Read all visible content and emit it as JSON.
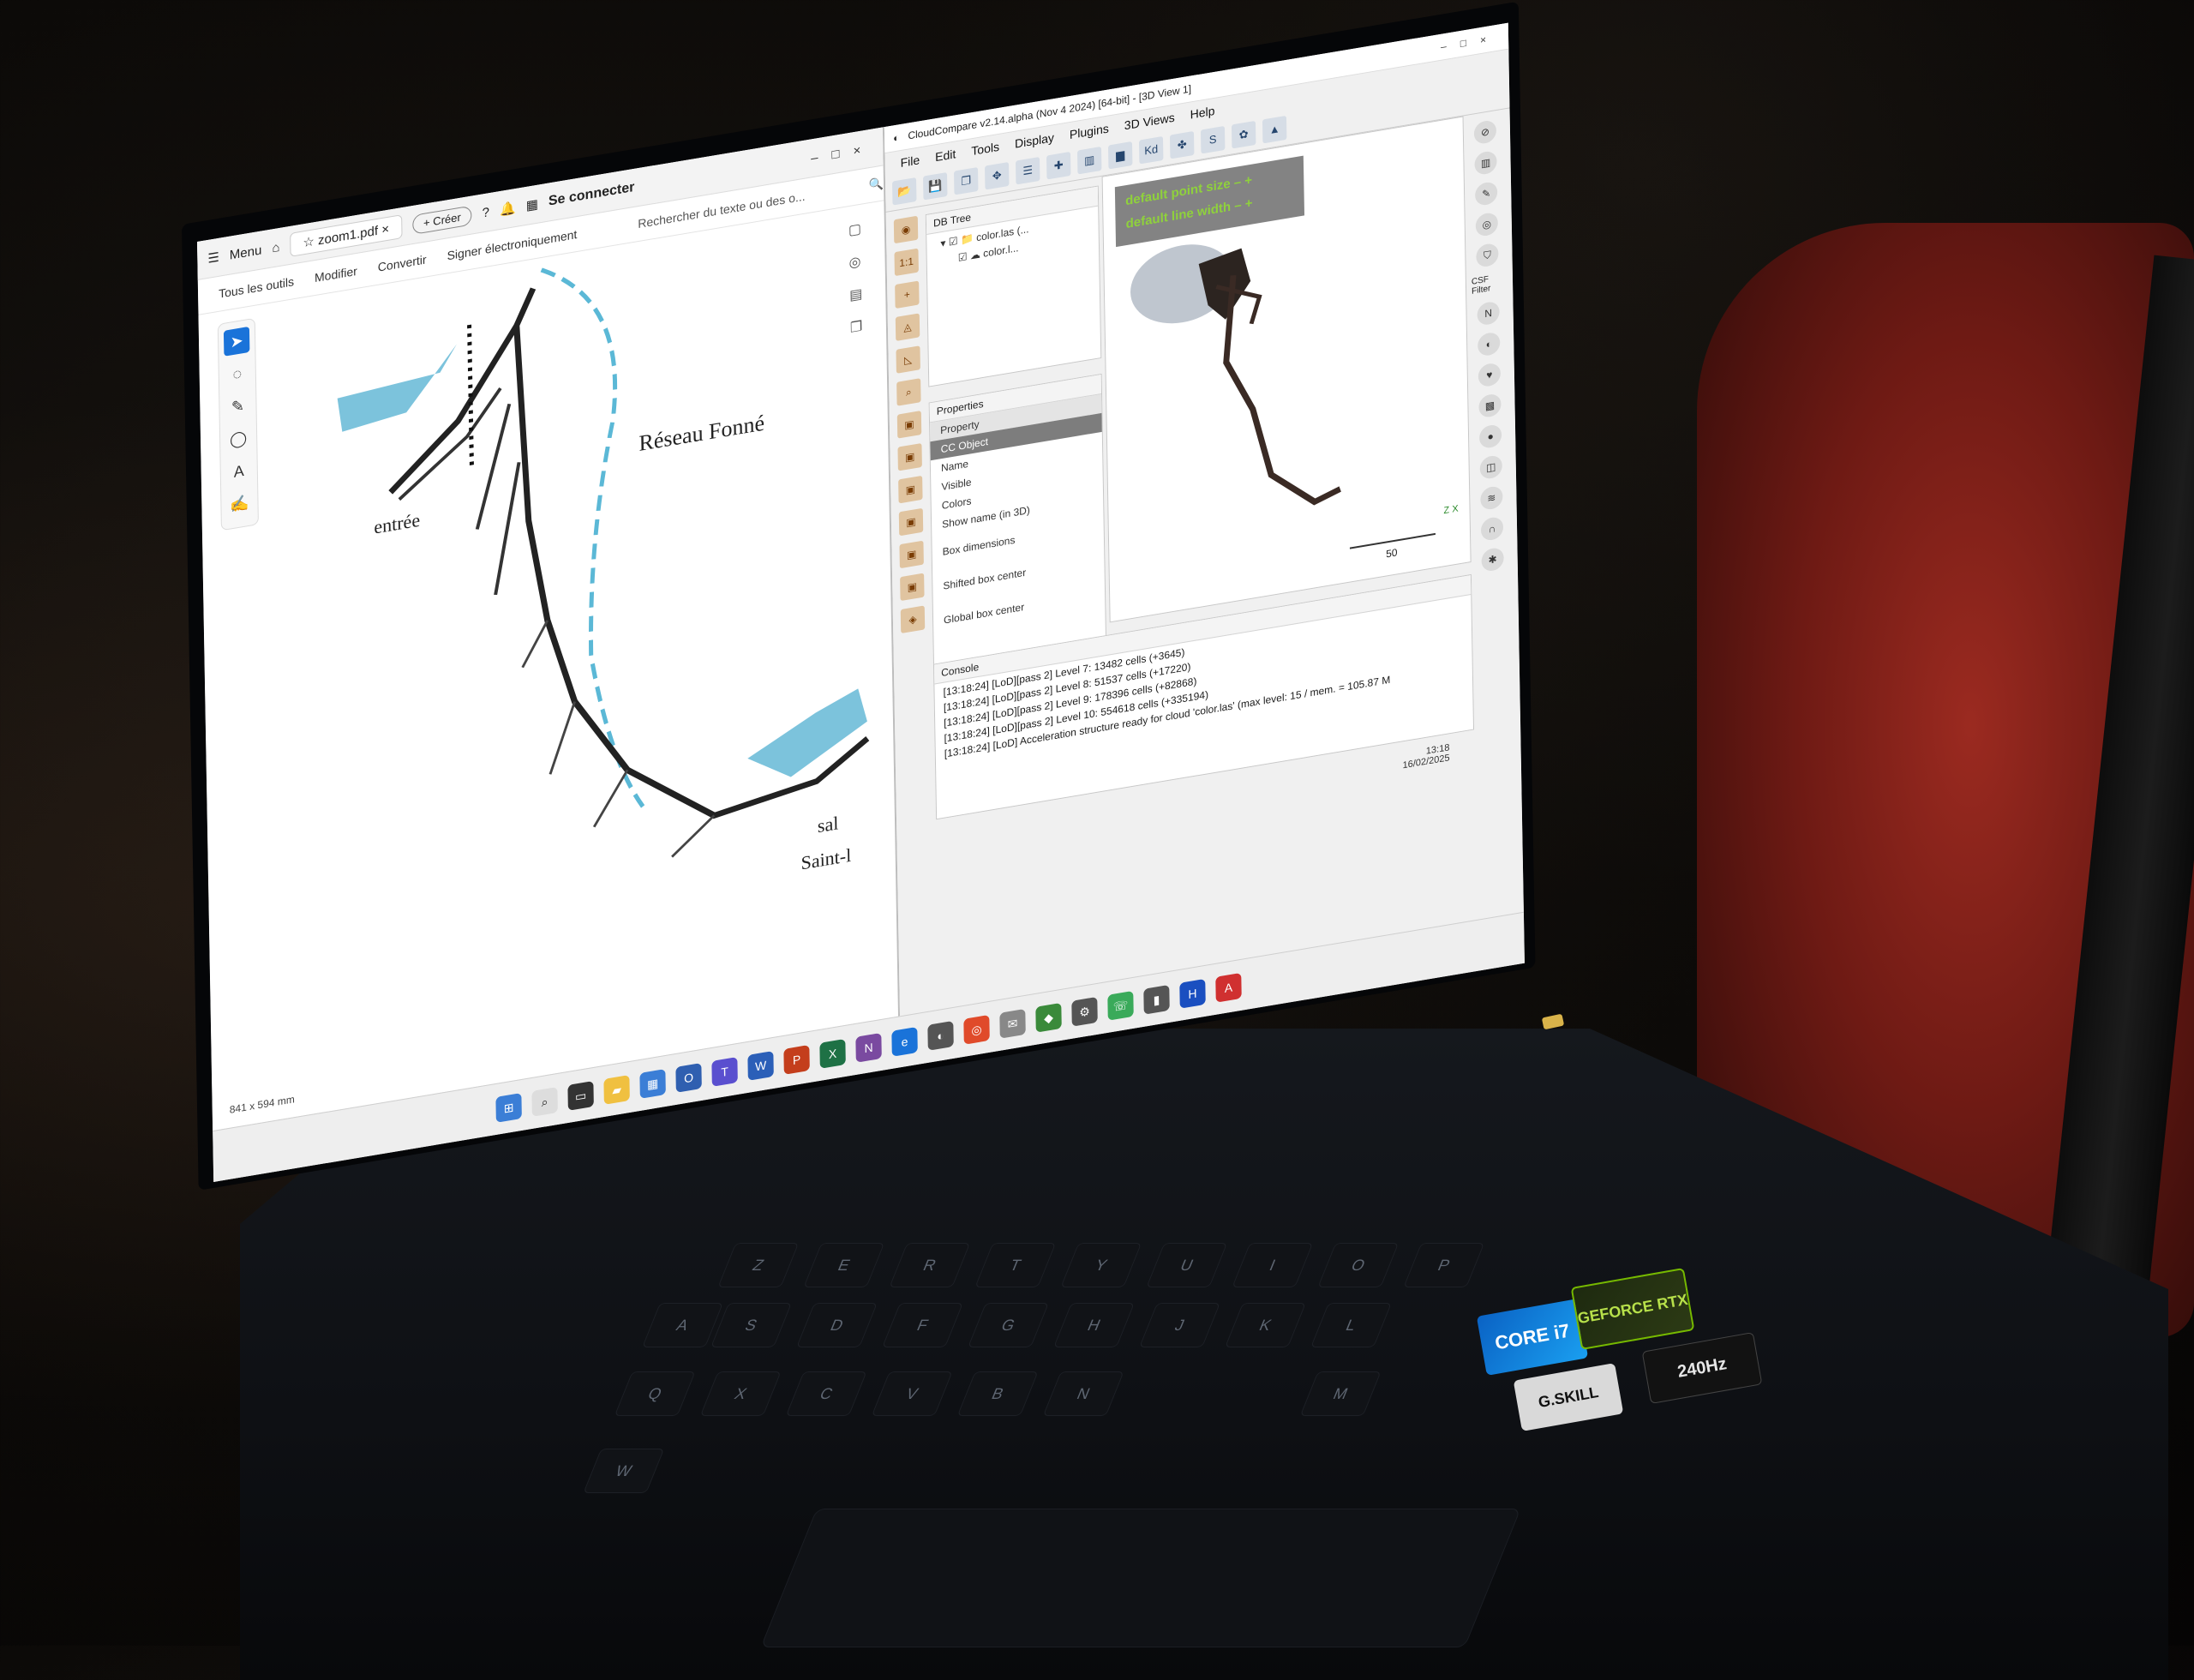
{
  "pdf": {
    "menu_label": "Menu",
    "tab_title": "zoom1.pdf",
    "create_label": "Créer",
    "login_label": "Se connecter",
    "menu_items": [
      "Tous les outils",
      "Modifier",
      "Convertir",
      "Signer électroniquement"
    ],
    "search_placeholder": "Rechercher du texte ou des o...",
    "map_title": "Réseau Fonné",
    "map_labels": [
      "entrée",
      "sal",
      "Saint-l"
    ],
    "status_size": "841 x 594 mm"
  },
  "cc": {
    "title": "CloudCompare v2.14.alpha (Nov 4 2024) [64-bit] - [3D View 1]",
    "menus": [
      "File",
      "Edit",
      "Tools",
      "Display",
      "Plugins",
      "3D Views",
      "Help"
    ],
    "dbtree": {
      "header": "DB Tree",
      "items": [
        "color.las (...",
        "color.l..."
      ]
    },
    "properties": {
      "header": "Properties",
      "rows": [
        "Property",
        "CC Object",
        "Name",
        "Visible",
        "Colors",
        "Show name (in 3D)",
        "Box dimensions",
        "Shifted box center",
        "Global box center"
      ]
    },
    "view": {
      "overlay_point": "default point size",
      "overlay_line": "default line width",
      "scale_label": "50",
      "axes_label": "Z X"
    },
    "console": {
      "header": "Console",
      "lines": [
        "[13:18:24] [LoD][pass 2] Level 7: 13482 cells (+3645)",
        "[13:18:24] [LoD][pass 2] Level 8: 51537 cells (+17220)",
        "[13:18:24] [LoD][pass 2] Level 9: 178396 cells (+82868)",
        "[13:18:24] [LoD][pass 2] Level 10: 554618 cells (+335194)",
        "[13:18:24] [LoD] Acceleration structure ready for cloud 'color.las' (max level: 15 / mem. = 105.87 M"
      ]
    },
    "righttools": {
      "csf_label": "CSF Filter"
    },
    "tray": {
      "time": "13:18",
      "date": "16/02/2025"
    }
  },
  "keyboard": {
    "keys": [
      "W",
      "Q",
      "X",
      "S",
      "Z",
      "A",
      "C",
      "D",
      "E",
      "V",
      "F",
      "R",
      "B",
      "G",
      "T",
      "N",
      "H",
      "Y",
      "J",
      "U",
      "K",
      "I",
      "L",
      "O",
      "M",
      "P"
    ]
  },
  "stickers": {
    "intel": "CORE i7",
    "nvidia": "GEFORCE RTX",
    "gskill": "G.SKILL",
    "hz": "240Hz"
  },
  "colors": {
    "accent_blue": "#1a73d9",
    "overlay_green": "#8fd13c",
    "bag_red": "#9b2a20"
  }
}
